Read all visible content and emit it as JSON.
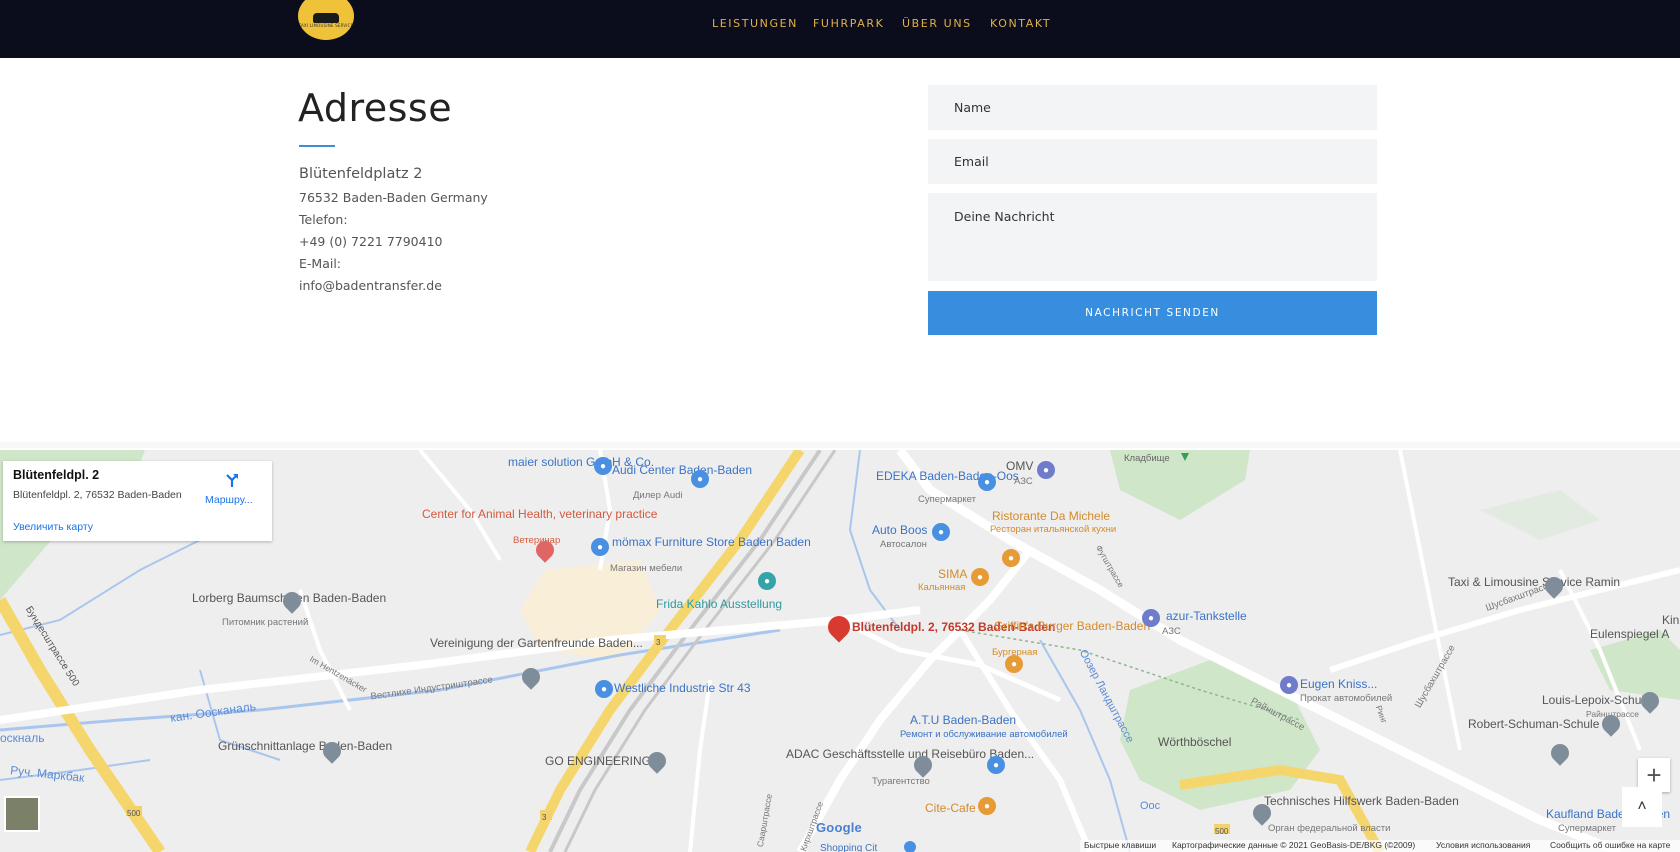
{
  "header": {
    "logo_text": "TAXI LIMOUSINE SERVICE",
    "nav": [
      "LEISTUNGEN",
      "FUHRPARK",
      "ÜBER UNS",
      "KONTAKT"
    ]
  },
  "address": {
    "title": "Adresse",
    "street": "Blütenfeldplatz 2",
    "city": "76532 Baden-Baden Germany",
    "phone_label": "Telefon:",
    "phone": "+49 (0) 7221 7790410",
    "email_label": "E-Mail:",
    "email": "info@badentransfer.de"
  },
  "form": {
    "name_placeholder": "Name",
    "email_placeholder": "Email",
    "message_placeholder": "Deine Nachricht",
    "send_label": "NACHRICHT SENDEN"
  },
  "map": {
    "card_title": "Blütenfeldpl. 2",
    "card_address": "Blütenfeldpl. 2, 76532 Baden-Baden",
    "card_enlarge": "Увеличить карту",
    "card_route": "Маршру...",
    "labels": {
      "maier": "maier solution GmbH & Co.",
      "audi": "Audi Center Baden-Baden",
      "audi_sub": "Дилер Audi",
      "animal": "Center for Animal Health, veterinary practice",
      "animal_sub": "Ветеринар",
      "momax": "mömax Furniture Store Baden Baden",
      "momax_sub": "Магазин мебели",
      "lorberg": "Lorberg Baumschulen Baden-Baden",
      "lorberg_sub": "Питомник растений",
      "frida": "Frida Kahlo Ausstellung",
      "verein": "Vereinigung der Gartenfreunde Baden...",
      "westliche": "Westliche Industrie Str 43",
      "gruen": "Grünschnittanlage Baden-Baden",
      "go": "GO ENGINEERING",
      "adac": "ADAC Geschäftsstelle und Reisebüro Baden...",
      "adac_sub": "Турагентство",
      "target": "Blütenfeldpl. 2, 76532 Baden-Baden",
      "edeka": "EDEKA Baden-Baden-Oos",
      "edeka_sub": "Супермаркет",
      "omv": "OMV",
      "omv_sub": "АЗС",
      "autoboos": "Auto Boos",
      "autoboos_sub": "Автосалон",
      "ristorante": "Ristorante Da Michele",
      "ristorante_sub": "Ресторан итальянской кухни",
      "sima": "SIMA",
      "sima_sub": "Кальянная",
      "griffins": "Griffin's Burger Baden-Baden",
      "griffins_sub": "Бургерная",
      "atu": "A.T.U Baden-Baden",
      "atu_sub": "Ремонт и обслуживание автомобилей",
      "citecafe": "Cite-Cafe",
      "azur": "azur-Tankstelle",
      "azur_sub": "АЗС",
      "eugen": "Eugen Kniss...",
      "eugen_sub": "Прокат автомобилей",
      "worth": "Wörthböschel",
      "taxi": "Taxi & Limousine Service Ramin",
      "euler": "Eulenspiegel A",
      "lepoix": "Louis-Lepoix-Schule",
      "schuman": "Robert-Schuman-Schule",
      "thw": "Technisches Hilfswerk Baden-Baden",
      "thw_sub": "Орган федеральной власти",
      "kaufland": "Kaufland Baden-Baden",
      "kaufland_sub": "Супермаркет",
      "kladbische": "Кладбище",
      "kanal": "кан. Оосканаль",
      "kanal2": "оскналь",
      "markbak": "Руч. Маркбак",
      "westliche_str": "Вестлихе Индустриштрассе",
      "raynstr": "Райнштрассе",
      "ooser": "Оозер Ландштрассе",
      "schussbach": "Шусбахштрассе",
      "schussbach2": "Шусбахштрассе",
      "bundes": "Бундесштрассе 500",
      "im_hentzenacker": "Im Hentzenäcker",
      "saarstr": "Саарштрассе",
      "ooschtr": "Оос",
      "ring": "Ринг",
      "flugstr": "Фугштрассе",
      "rheinstr": "Райнштрассе",
      "k_oschtr": "Кирхштрассе",
      "shield_3": "3",
      "shield_500": "500",
      "shopping": "Shopping Cit",
      "kin": "Kin"
    },
    "google": "Google",
    "footer": [
      "Быстрые клавиши",
      "Картографические данные © 2021 GeoBasis-DE/BKG (©2009)",
      "Условия использования",
      "Сообщить об ошибке на карте"
    ],
    "zoom_in": "+",
    "scroll_up": "˄"
  }
}
